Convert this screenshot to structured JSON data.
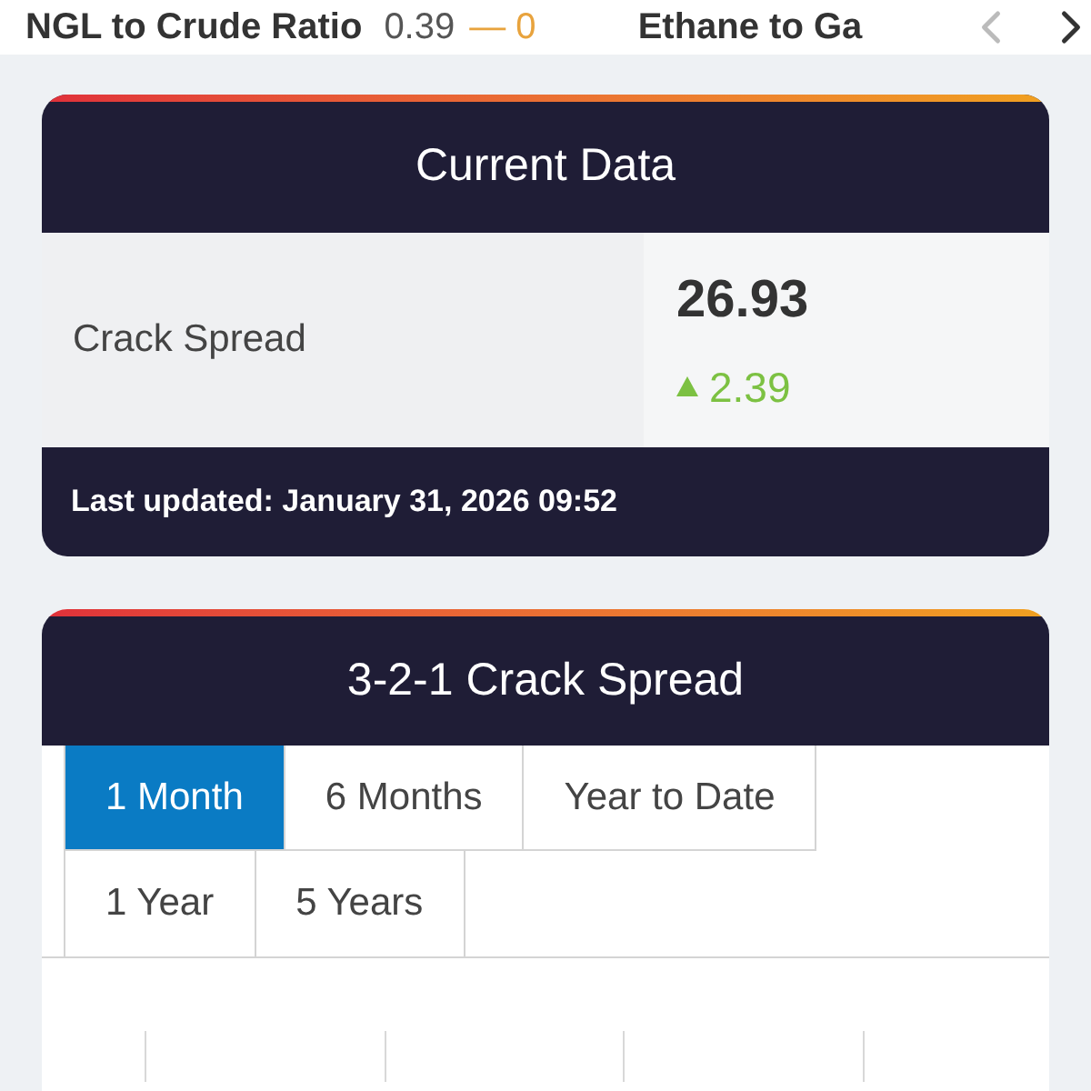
{
  "ticker": {
    "items": [
      {
        "name": "NGL to Crude Ratio",
        "value": "0.39",
        "change": "— 0",
        "kind": "flat"
      },
      {
        "name": "Ethane to Ga"
      }
    ],
    "prev_disabled": true,
    "next_disabled": false
  },
  "current_data": {
    "title": "Current Data",
    "label": "Crack Spread",
    "value": "26.93",
    "change": "2.39",
    "kind": "up",
    "updated": "Last updated: January 31, 2026 09:52"
  },
  "chart_card": {
    "title": "3-2-1 Crack Spread",
    "tabs": [
      {
        "label": "1 Month",
        "selected": true
      },
      {
        "label": "6 Months",
        "selected": false
      },
      {
        "label": "Year to Date",
        "selected": false
      },
      {
        "label": "1 Year",
        "selected": false
      },
      {
        "label": "5 Years",
        "selected": false
      }
    ]
  }
}
